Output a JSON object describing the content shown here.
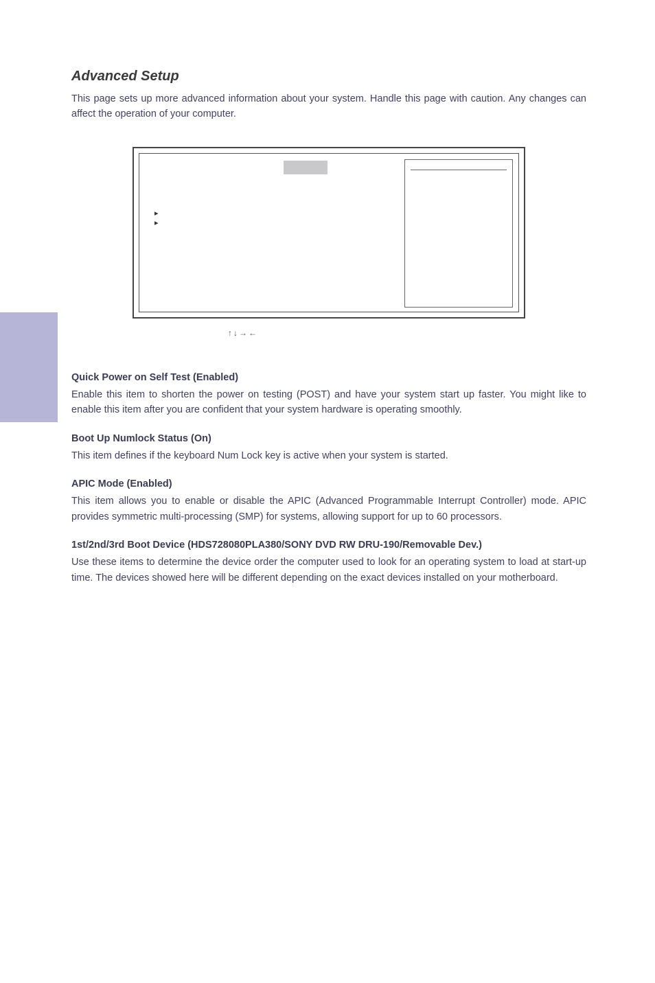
{
  "section_title": "Advanced Setup",
  "intro": "This page sets up more advanced information about your system. Handle this page with caution. Any changes can affect the operation of your computer.",
  "nav_legend": "↑↓→←",
  "items": [
    {
      "heading": "Quick Power on Self Test (Enabled)",
      "body": "Enable this item to shorten the power on testing (POST) and have your system start up faster. You might like to enable this item after you are confident that your system hardware is operating smoothly."
    },
    {
      "heading": "Boot Up Numlock Status (On)",
      "body": "This item defines if the keyboard Num Lock key is active when your system is started."
    },
    {
      "heading": "APIC Mode (Enabled)",
      "body": "This item allows you to enable or disable the APIC (Advanced Programmable Interrupt Controller) mode. APIC provides symmetric multi-processing (SMP) for systems, allowing support for up to 60 processors."
    },
    {
      "heading": "1st/2nd/3rd Boot Device (HDS728080PLA380/SONY DVD RW DRU-190/Removable Dev.)",
      "body": "Use these items to determine the device order the computer used to look for an operating system to load at start-up time. The devices showed here will be different depending on the exact devices installed on your motherboard."
    }
  ]
}
